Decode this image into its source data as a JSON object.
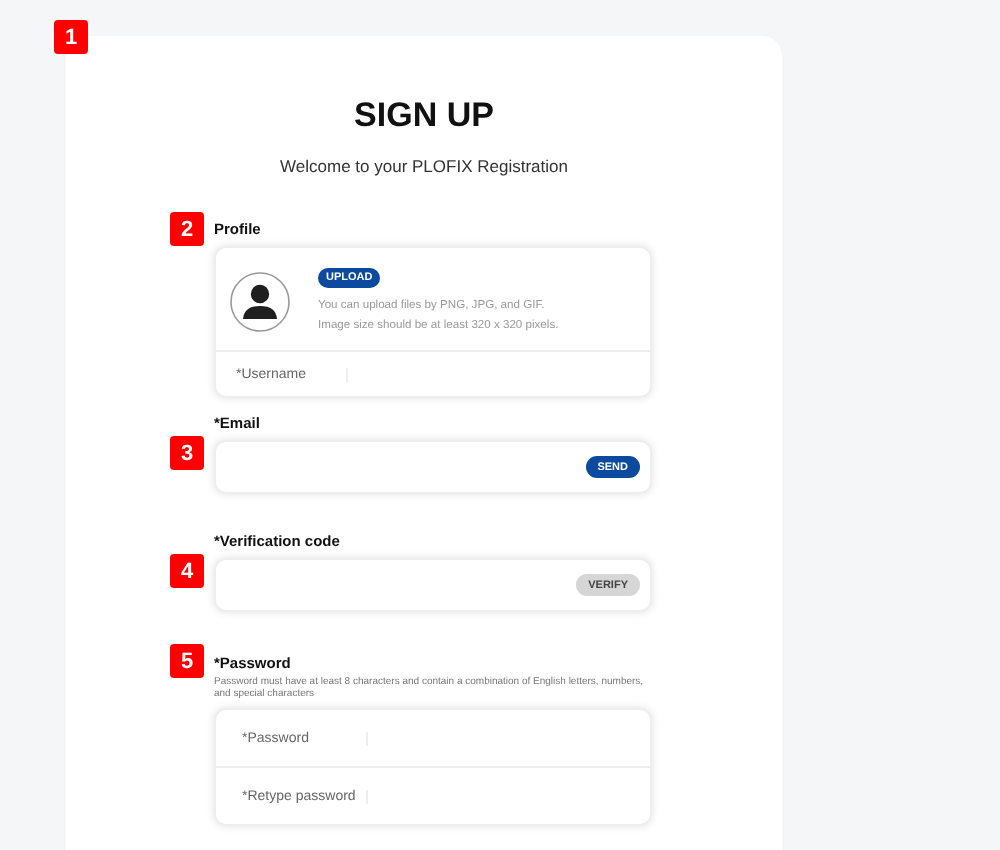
{
  "card_marker": "1",
  "title": "SIGN UP",
  "subtitle": "Welcome to your PLOFIX Registration",
  "profile": {
    "marker": "2",
    "label": "Profile",
    "upload_button": "UPLOAD",
    "hint_lines": [
      "You can upload files by PNG, JPG, and GIF.",
      "Image size should be at least 320 x 320 pixels."
    ],
    "username_label": "*Username"
  },
  "email": {
    "marker": "3",
    "label": "*Email",
    "button": "SEND",
    "button_enabled": true
  },
  "verification": {
    "marker": "4",
    "label": "*Verification code",
    "button": "VERIFY",
    "button_enabled": false
  },
  "password": {
    "marker": "5",
    "label": "*Password",
    "hint": "Password must have at least 8 characters and contain a combination of English letters, numbers, and special characters",
    "fields": [
      "*Password",
      "*Retype password"
    ]
  }
}
